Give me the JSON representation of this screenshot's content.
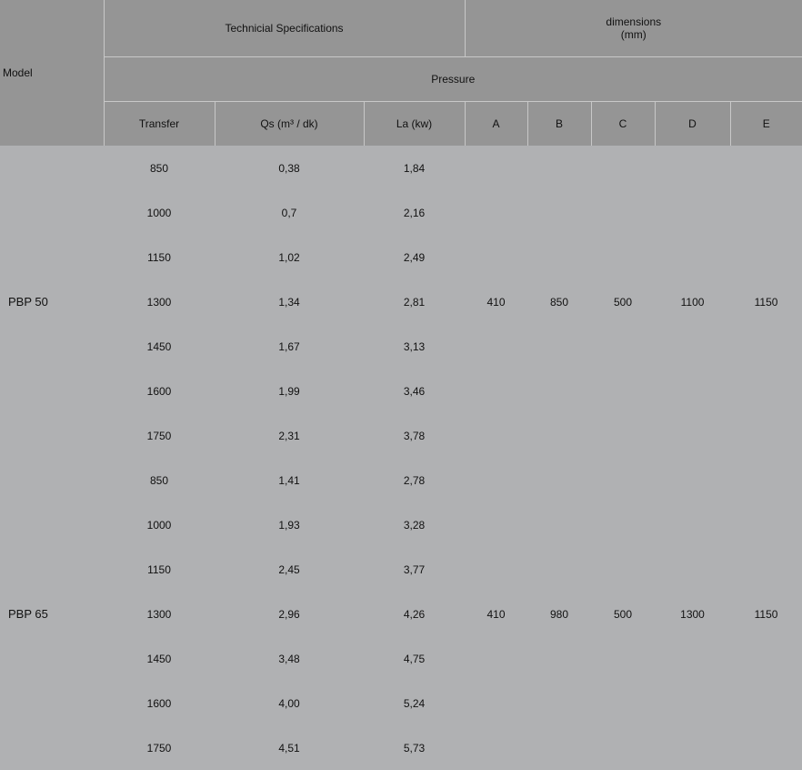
{
  "header": {
    "model": "Model",
    "technical": "Technicial Specifications",
    "dimensions_line1": "dimensions",
    "dimensions_line2": "(mm)",
    "pressure": "Pressure",
    "transfer": "Transfer",
    "qs": "Qs (m³ / dk)",
    "la": "La (kw)",
    "a": "A",
    "b": "B",
    "c": "C",
    "d": "D",
    "e": "E"
  },
  "groups": [
    {
      "model": "PBP 50",
      "dims": {
        "a": "410",
        "b": "850",
        "c": "500",
        "d": "1100",
        "e": "1150"
      },
      "rows": [
        {
          "transfer": "850",
          "qs": "0,38",
          "la": "1,84"
        },
        {
          "transfer": "1000",
          "qs": "0,7",
          "la": "2,16"
        },
        {
          "transfer": "1150",
          "qs": "1,02",
          "la": "2,49"
        },
        {
          "transfer": "1300",
          "qs": "1,34",
          "la": "2,81"
        },
        {
          "transfer": "1450",
          "qs": "1,67",
          "la": "3,13"
        },
        {
          "transfer": "1600",
          "qs": "1,99",
          "la": "3,46"
        },
        {
          "transfer": "1750",
          "qs": "2,31",
          "la": "3,78"
        }
      ]
    },
    {
      "model": "PBP 65",
      "dims": {
        "a": "410",
        "b": "980",
        "c": "500",
        "d": "1300",
        "e": "1150"
      },
      "rows": [
        {
          "transfer": "850",
          "qs": "1,41",
          "la": "2,78"
        },
        {
          "transfer": "1000",
          "qs": "1,93",
          "la": "3,28"
        },
        {
          "transfer": "1150",
          "qs": "2,45",
          "la": "3,77"
        },
        {
          "transfer": "1300",
          "qs": "2,96",
          "la": "4,26"
        },
        {
          "transfer": "1450",
          "qs": "3,48",
          "la": "4,75"
        },
        {
          "transfer": "1600",
          "qs": "4,00",
          "la": "5,24"
        },
        {
          "transfer": "1750",
          "qs": "4,51",
          "la": "5,73"
        }
      ]
    }
  ]
}
